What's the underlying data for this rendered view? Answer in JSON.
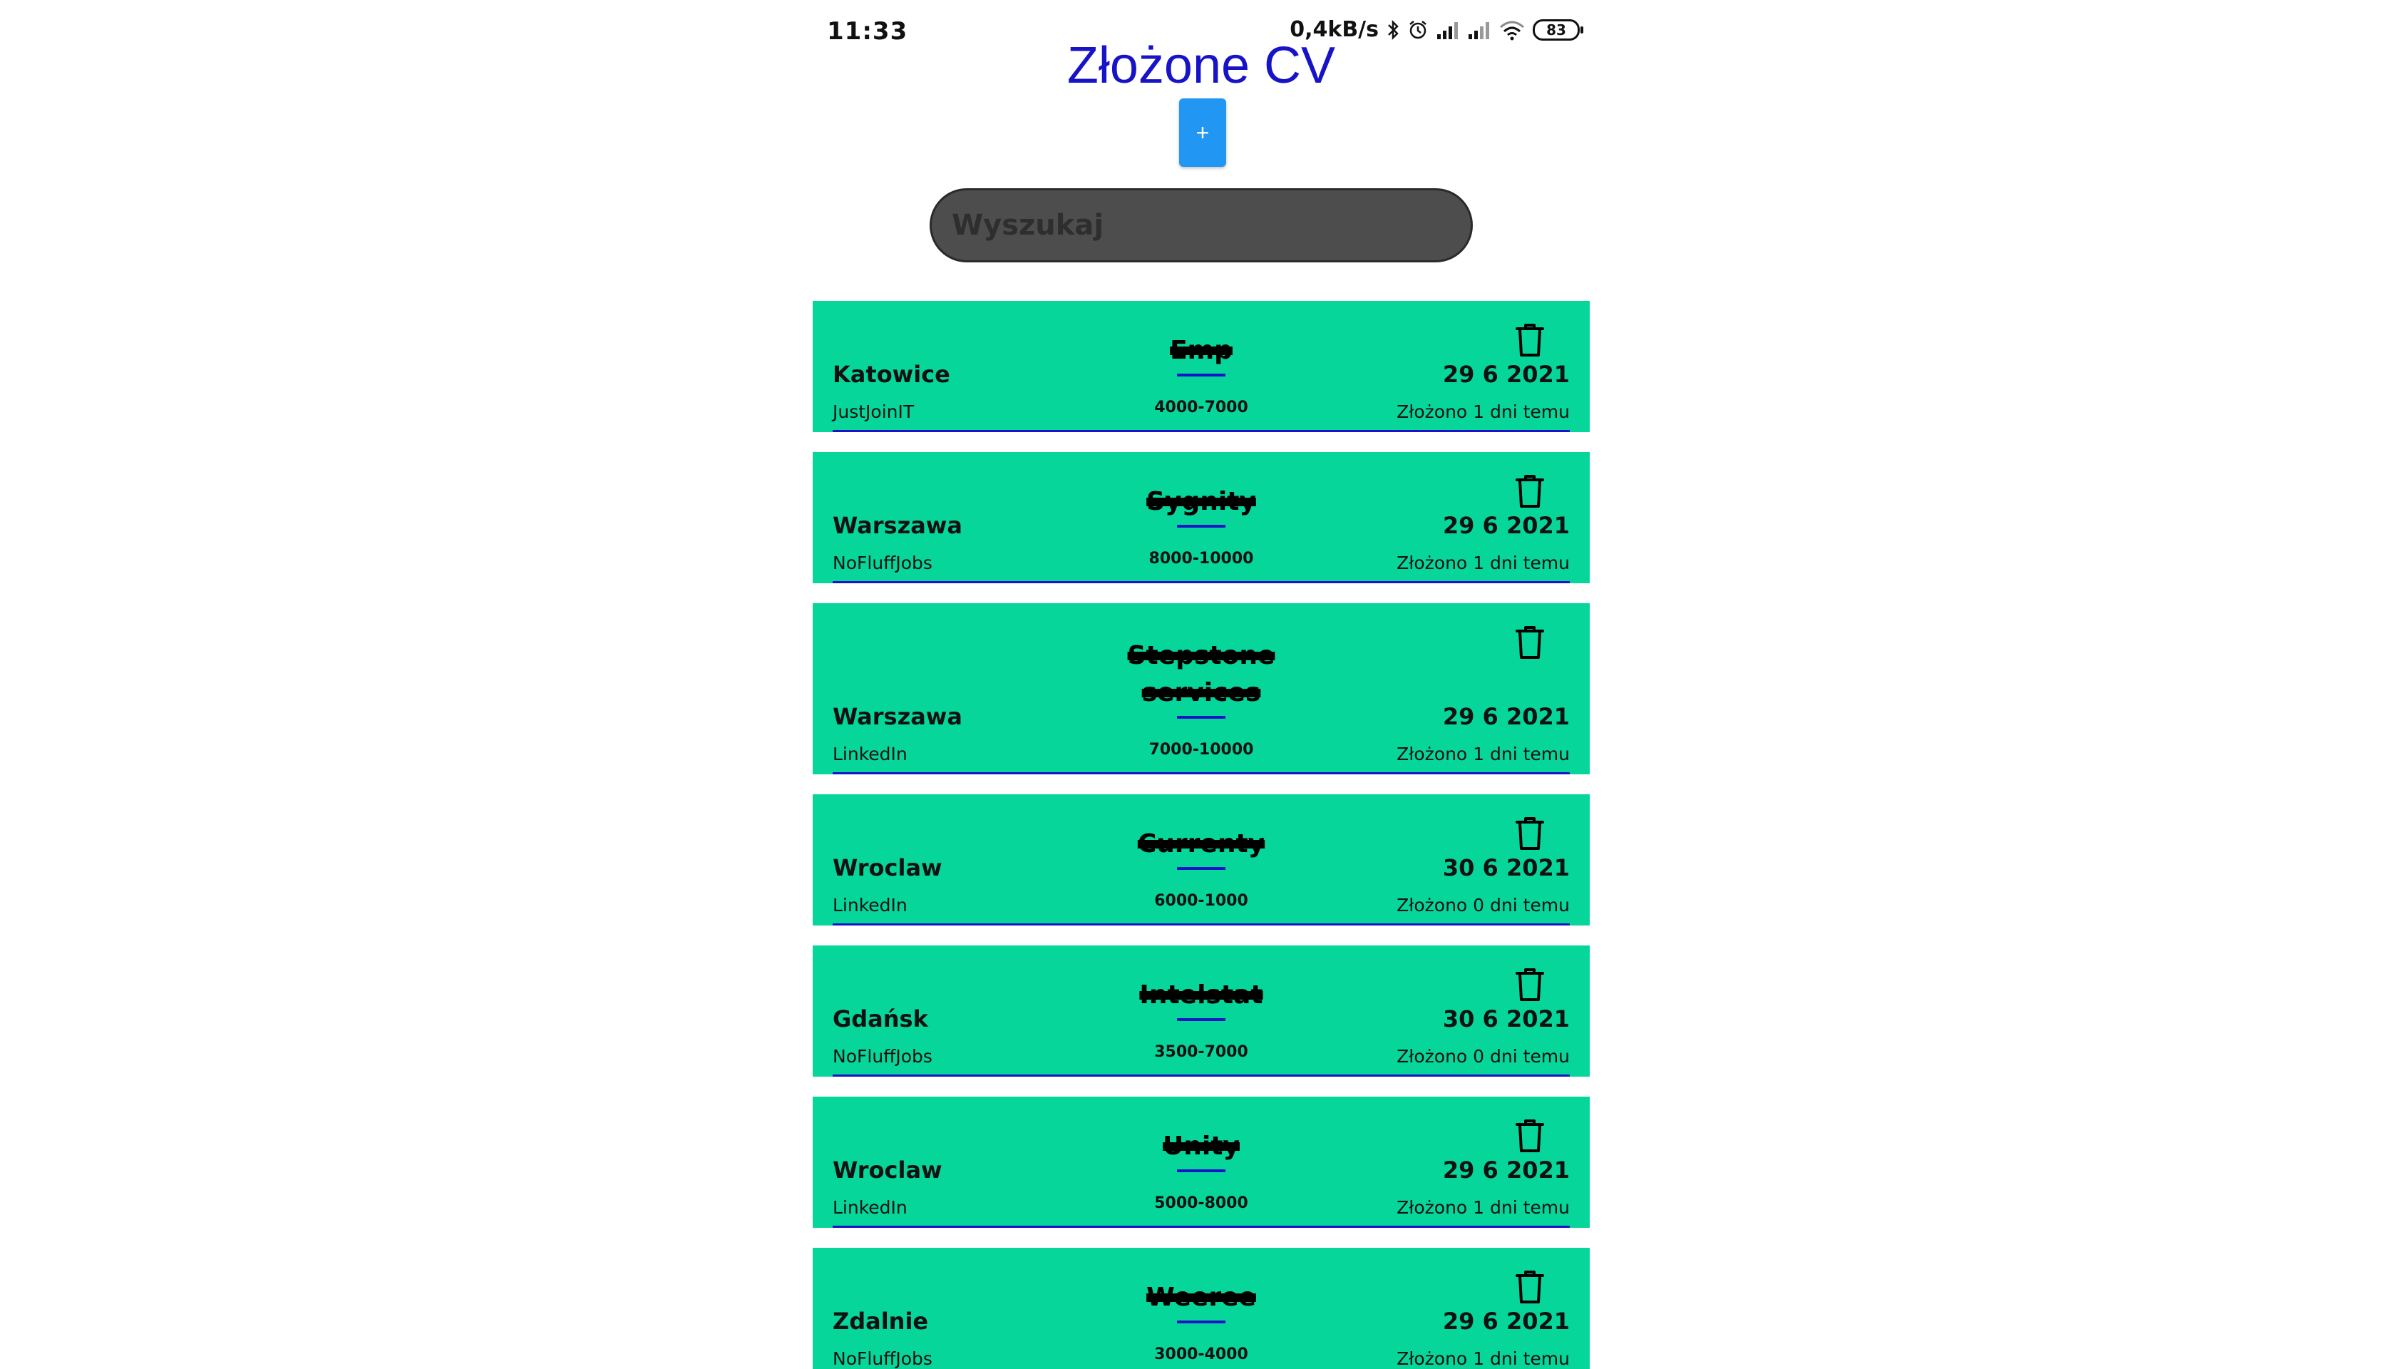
{
  "status_bar": {
    "time": "11:33",
    "network_speed": "0,4kB/s",
    "battery": "83",
    "icons": [
      "bluetooth-icon",
      "alarm-icon",
      "signal-icon",
      "signal-icon",
      "wifi-icon",
      "battery-icon"
    ]
  },
  "header": {
    "title": "Złożone CV",
    "add_label": "+"
  },
  "search": {
    "placeholder": "Wyszukaj",
    "value": ""
  },
  "colors": {
    "card_bg": "#07d69b",
    "title": "#1713c7",
    "add_button": "#2196f3",
    "search_bg": "#4d4d4d",
    "accent_line": "#1713c7"
  },
  "applications": [
    {
      "city": "Katowice",
      "source": "JustJoinIT",
      "company": "Emp",
      "salary": "4000-7000",
      "date": "29 6 2021",
      "applied": "Złożono 1 dni temu"
    },
    {
      "city": "Warszawa",
      "source": "NoFluffJobs",
      "company": "Sygnity",
      "salary": "8000-10000",
      "date": "29 6 2021",
      "applied": "Złożono 1 dni temu"
    },
    {
      "city": "Warszawa",
      "source": "LinkedIn",
      "company": "Stepstone services",
      "salary": "7000-10000",
      "date": "29 6 2021",
      "applied": "Złożono 1 dni temu"
    },
    {
      "city": "Wroclaw",
      "source": "LinkedIn",
      "company": "Currenty",
      "salary": "6000-1000",
      "date": "30 6 2021",
      "applied": "Złożono 0 dni temu"
    },
    {
      "city": "Gdańsk",
      "source": "NoFluffJobs",
      "company": "Intelstat",
      "salary": "3500-7000",
      "date": "30 6 2021",
      "applied": "Złożono 0 dni temu"
    },
    {
      "city": "Wroclaw",
      "source": "LinkedIn",
      "company": "Unity",
      "salary": "5000-8000",
      "date": "29 6 2021",
      "applied": "Złożono 1 dni temu"
    },
    {
      "city": "Zdalnie",
      "source": "NoFluffJobs",
      "company": "Weeree",
      "salary": "3000-4000",
      "date": "29 6 2021",
      "applied": "Złożono 1 dni temu"
    }
  ]
}
